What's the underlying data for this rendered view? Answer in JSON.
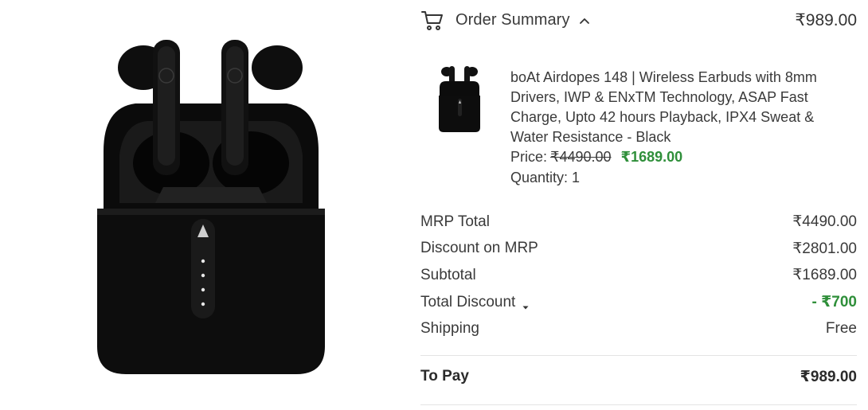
{
  "summary": {
    "title": "Order Summary",
    "total": "₹989.00"
  },
  "item": {
    "name": "boAt Airdopes 148 | Wireless Earbuds with 8mm Drivers, IWP & ENxTM Technology, ASAP Fast Charge, Upto 42 hours Playback, IPX4 Sweat & Water Resistance - Black",
    "price_label": "Price:",
    "mrp": "₹4490.00",
    "sale_price": "₹1689.00",
    "quantity": "Quantity: 1"
  },
  "breakdown": [
    {
      "label": "MRP Total",
      "value": "₹4490.00"
    },
    {
      "label": "Discount on MRP",
      "value": "₹2801.00"
    },
    {
      "label": "Subtotal",
      "value": "₹1689.00"
    },
    {
      "label": "Total Discount",
      "value": "- ₹700"
    },
    {
      "label": "Shipping",
      "value": "Free"
    }
  ],
  "to_pay": {
    "label": "To Pay",
    "value": "₹989.00"
  },
  "colors": {
    "accent_green": "#2f8f3a",
    "text": "#3a3a3a",
    "divider": "#e4e4e4"
  },
  "icons": [
    "cart-icon",
    "chevron-up-icon",
    "caret-down-icon"
  ]
}
